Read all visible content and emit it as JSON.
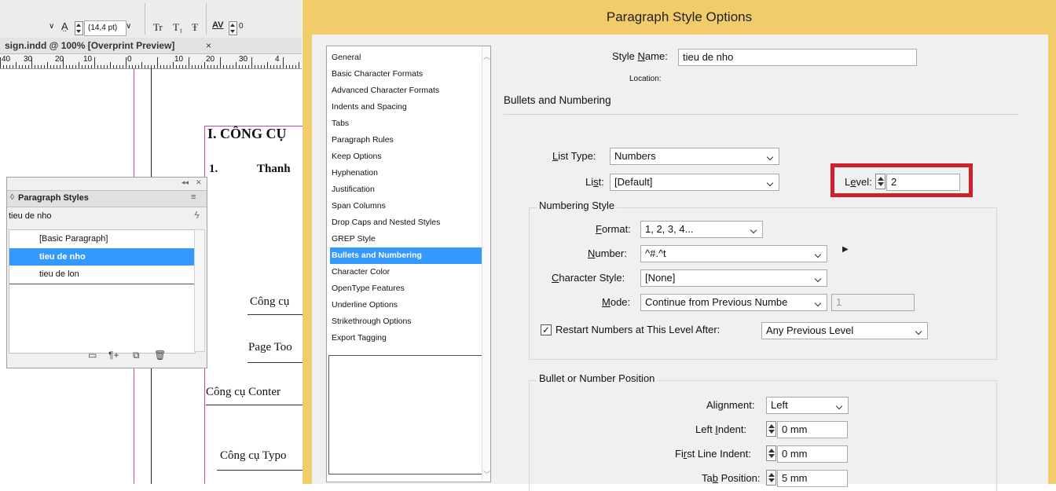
{
  "toolbar": {
    "font_size_select": "(14,4 pt)",
    "tracking_value": "0",
    "tt_caps": "Tr",
    "tt_sub": "T₁",
    "tt_strike": "Ŧ"
  },
  "document": {
    "tab_title": "sign.indd @ 100% [Overprint Preview]",
    "tab_close": "×",
    "ruler_labels": [
      "40",
      "30",
      "20",
      "10",
      "0",
      "10",
      "20",
      "30",
      "4"
    ],
    "heading": "I. CÔNG CỤ",
    "subheading_number": "1.",
    "subheading_text": "Thanh",
    "text_1": "Công cụ",
    "text_2": "Page Too",
    "text_3": "Công cụ Conter",
    "text_4": "Công cụ Typo"
  },
  "paragraph_styles_panel": {
    "title": "Paragraph Styles",
    "collapse_glyph": "◂◂",
    "close_glyph": "✕",
    "current_style": "tieu de nho",
    "items": [
      {
        "label": "[Basic Paragraph]",
        "selected": false
      },
      {
        "label": "tieu de nho",
        "selected": true
      },
      {
        "label": "tieu de lon",
        "selected": false
      }
    ]
  },
  "dialog": {
    "title": "Paragraph Style Options",
    "categories": [
      {
        "label": "General",
        "selected": false
      },
      {
        "label": "Basic Character Formats",
        "selected": false
      },
      {
        "label": "Advanced Character Formats",
        "selected": false
      },
      {
        "label": "Indents and Spacing",
        "selected": false
      },
      {
        "label": "Tabs",
        "selected": false
      },
      {
        "label": "Paragraph Rules",
        "selected": false
      },
      {
        "label": "Keep Options",
        "selected": false
      },
      {
        "label": "Hyphenation",
        "selected": false
      },
      {
        "label": "Justification",
        "selected": false
      },
      {
        "label": "Span Columns",
        "selected": false
      },
      {
        "label": "Drop Caps and Nested Styles",
        "selected": false
      },
      {
        "label": "GREP Style",
        "selected": false
      },
      {
        "label": "Bullets and Numbering",
        "selected": true
      },
      {
        "label": "Character Color",
        "selected": false
      },
      {
        "label": "OpenType Features",
        "selected": false
      },
      {
        "label": "Underline Options",
        "selected": false
      },
      {
        "label": "Strikethrough Options",
        "selected": false
      },
      {
        "label": "Export Tagging",
        "selected": false
      }
    ],
    "style_name_label_pre": "Style ",
    "style_name_label_u": "N",
    "style_name_label_post": "ame:",
    "style_name_value": "tieu de nho",
    "location_label": "Location:",
    "section_title": "Bullets and Numbering",
    "list_type_label_pre": "",
    "list_type_label_u": "L",
    "list_type_label_post": "ist Type:",
    "list_type_value": "Numbers",
    "list_label_pre": "Li",
    "list_label_u": "s",
    "list_label_post": "t:",
    "list_value": "[Default]",
    "level_label_pre": "L",
    "level_label_u": "e",
    "level_label_post": "vel:",
    "level_value": "2",
    "highlight_color": "#d0202a",
    "numbering_style_title": "Numbering Style",
    "format_label_pre": "",
    "format_label_u": "F",
    "format_label_post": "ormat:",
    "format_value": "1, 2, 3, 4...",
    "number_label_pre": "",
    "number_label_u": "N",
    "number_label_post": "umber:",
    "number_value": "^#.^t",
    "char_style_label_pre": "",
    "char_style_label_u": "C",
    "char_style_label_post": "haracter Style:",
    "char_style_value": "[None]",
    "mode_label_pre": "",
    "mode_label_u": "M",
    "mode_label_post": "ode:",
    "mode_value": "Continue from Previous Numbe",
    "mode_start_value": "1",
    "restart_label": "Restart Numbers at This Level After:",
    "restart_checked": true,
    "restart_value": "Any Previous Level",
    "position_title": "Bullet or Number Position",
    "alignment_label_pre": "Ali",
    "alignment_label_u": "g",
    "alignment_label_post": "nment:",
    "alignment_value": "Left",
    "left_indent_label_pre": "Left ",
    "left_indent_label_u": "I",
    "left_indent_label_post": "ndent:",
    "left_indent_value": "0 mm",
    "first_indent_label_pre": "Fi",
    "first_indent_label_u": "r",
    "first_indent_label_post": "st Line Indent:",
    "first_indent_value": "0 mm",
    "tab_pos_label_pre": "Ta",
    "tab_pos_label_u": "b",
    "tab_pos_label_post": " Position:",
    "tab_pos_value": "5 mm"
  }
}
